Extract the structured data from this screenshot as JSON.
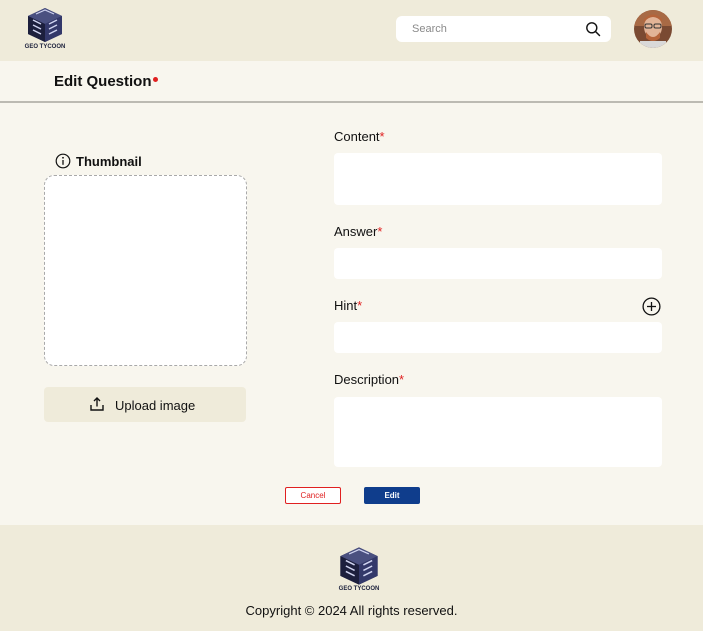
{
  "header": {
    "logo_text": "GEO TYCOON",
    "search_placeholder": "Search"
  },
  "page": {
    "title": "Edit Question",
    "title_required_marker": "•"
  },
  "thumbnail": {
    "label": "Thumbnail",
    "upload_label": "Upload image"
  },
  "form": {
    "content_label": "Content",
    "answer_label": "Answer",
    "hint_label": "Hint",
    "description_label": "Description",
    "required_marker": "*"
  },
  "actions": {
    "cancel_label": "Cancel",
    "edit_label": "Edit"
  },
  "footer": {
    "logo_text": "GEO TYCOON",
    "copyright": "Copyright © 2024 All rights reserved."
  },
  "colors": {
    "header_bg": "#efebda",
    "page_bg": "#f8f6ee",
    "required": "#e02020",
    "primary": "#0f3d8c"
  }
}
